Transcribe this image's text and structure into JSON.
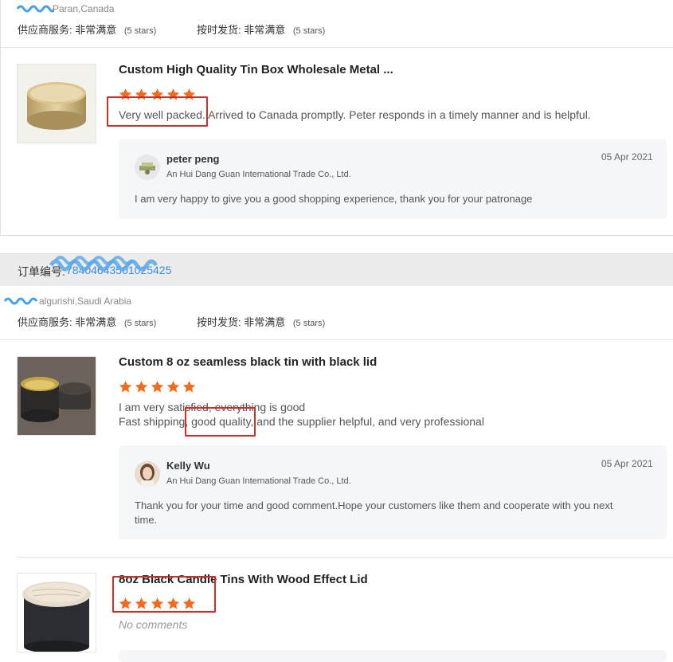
{
  "card1": {
    "buyer_name_suffix": "Paran,Canada",
    "supplier_service_label": "供应商服务:",
    "supplier_service_value": "非常满意",
    "supplier_service_stars": "(5 stars)",
    "ontime_label": "按时发货:",
    "ontime_value": "非常满意",
    "ontime_stars": "(5 stars)",
    "product_title": "Custom High Quality Tin Box Wholesale Metal ...",
    "rating": 5,
    "review_highlight": "Very well packed.",
    "review_rest": " Arrived to Canada promptly. Peter responds in a timely manner and is helpful.",
    "reply": {
      "name": "peter peng",
      "company": "An Hui Dang Guan International Trade Co., Ltd.",
      "date": "05 Apr 2021",
      "text": "I am very happy to give you a good shopping experience, thank you for your patronage"
    }
  },
  "order": {
    "label": "订单编号:",
    "number": "78404643501025425"
  },
  "card2": {
    "buyer_name_suffix": "algurishi,Saudi Arabia",
    "supplier_service_label": "供应商服务:",
    "supplier_service_value": "非常满意",
    "supplier_service_stars": "(5 stars)",
    "ontime_label": "按时发货:",
    "ontime_value": "非常满意",
    "ontime_stars": "(5 stars)",
    "product_title": "Custom 8 oz seamless black tin with black lid",
    "rating": 5,
    "review_line1": "I am very satisfied, everything is good",
    "review_line2_pre": "Fast shipping, ",
    "review_line2_highlight": "good quality,",
    "review_line2_post": " and the supplier helpful, and very professional",
    "reply": {
      "name": "Kelly Wu",
      "company": "An Hui Dang Guan International Trade Co., Ltd.",
      "date": "05 Apr 2021",
      "text_line1": "Thank you for your time and good comment.Hope your customers like them and cooperate with you next",
      "text_line2": "time."
    }
  },
  "card3": {
    "product_title": "8oz Black Candle Tins With Wood Effect Lid",
    "rating": 5,
    "no_comments": "No comments"
  },
  "colors": {
    "star": "#f26a1b",
    "highlight_box": "#c9302c",
    "scribble": "#4aa0e6",
    "order_bar": "#ececec",
    "reply_bg": "#f5f6f8"
  }
}
